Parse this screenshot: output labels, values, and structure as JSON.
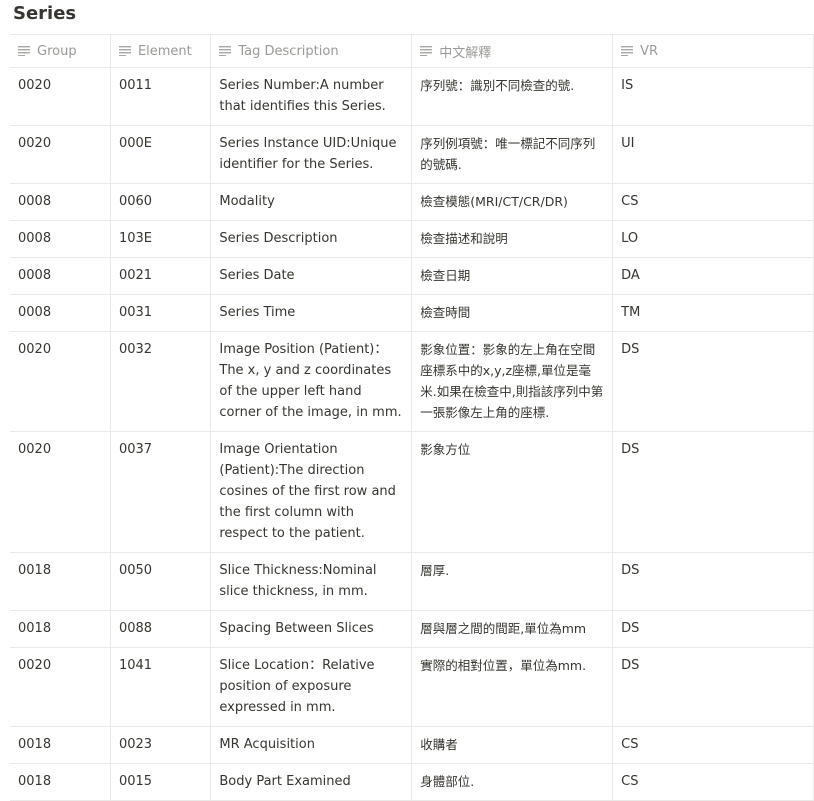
{
  "page": {
    "title": "Series"
  },
  "table": {
    "headers": [
      {
        "label": "Group",
        "icon": "text-lines-icon"
      },
      {
        "label": "Element",
        "icon": "text-lines-icon"
      },
      {
        "label": "Tag Description",
        "icon": "text-lines-icon"
      },
      {
        "label": "中文解釋",
        "icon": "text-lines-icon"
      },
      {
        "label": "VR",
        "icon": "text-lines-icon"
      }
    ],
    "rows": [
      {
        "group": "0020",
        "element": "0011",
        "desc": "Series Number:A number that identifies this Series.",
        "zh": "序列號：識別不同檢查的號.",
        "vr": "IS"
      },
      {
        "group": "0020",
        "element": "000E",
        "desc": "Series Instance UID:Unique identifier for the Series.",
        "zh": "序列例項號：唯一標記不同序列的號碼.",
        "vr": "UI"
      },
      {
        "group": "0008",
        "element": "0060",
        "desc": "Modality",
        "zh": "檢查模態(MRI/CT/CR/DR)",
        "vr": "CS"
      },
      {
        "group": "0008",
        "element": "103E",
        "desc": "Series Description",
        "zh": "檢查描述和說明",
        "vr": "LO"
      },
      {
        "group": "0008",
        "element": "0021",
        "desc": "Series Date",
        "zh": "檢查日期",
        "vr": "DA"
      },
      {
        "group": "0008",
        "element": "0031",
        "desc": "Series Time",
        "zh": "檢查時間",
        "vr": "TM"
      },
      {
        "group": "0020",
        "element": "0032",
        "desc": "Image Position (Patient)：The x, y and z coordinates of the upper left hand corner of the image, in mm.",
        "zh": "影象位置：影象的左上角在空間座標系中的x,y,z座標,單位是毫米.如果在檢查中,則指該序列中第一張影像左上角的座標.",
        "vr": "DS"
      },
      {
        "group": "0020",
        "element": "0037",
        "desc": "Image Orientation (Patient):The direction cosines of the first row and the first column with respect to the patient.",
        "zh": "影象方位",
        "vr": "DS"
      },
      {
        "group": "0018",
        "element": "0050",
        "desc": "Slice Thickness:Nominal slice thickness, in mm.",
        "zh": "層厚.",
        "vr": "DS"
      },
      {
        "group": "0018",
        "element": "0088",
        "desc": "Spacing Between Slices",
        "zh": "層與層之間的間距,單位為mm",
        "vr": "DS"
      },
      {
        "group": "0020",
        "element": "1041",
        "desc": "Slice Location：Relative position of exposure expressed in mm.",
        "zh": "實際的相對位置，單位為mm.",
        "vr": "DS"
      },
      {
        "group": "0018",
        "element": "0023",
        "desc": "MR Acquisition",
        "zh": "收購者",
        "vr": "CS"
      },
      {
        "group": "0018",
        "element": "0015",
        "desc": "Body Part Examined",
        "zh": "身體部位.",
        "vr": "CS"
      }
    ]
  }
}
